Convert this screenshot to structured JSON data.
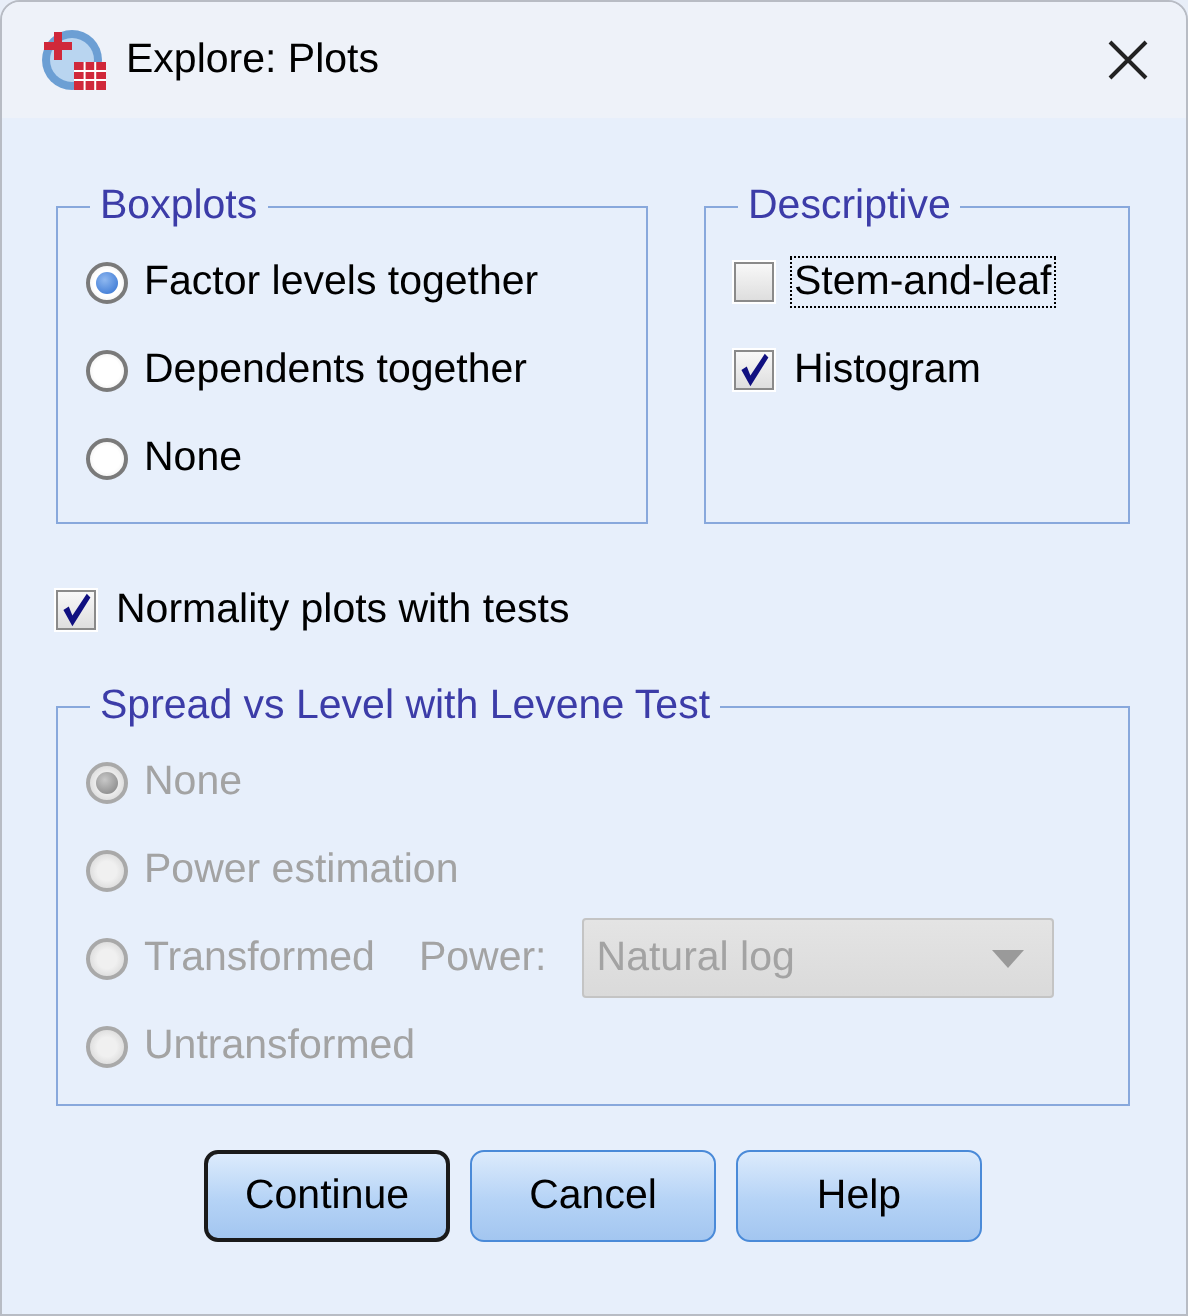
{
  "window": {
    "title": "Explore: Plots"
  },
  "boxplots": {
    "title": "Boxplots",
    "options": [
      {
        "label": "Factor levels together",
        "selected": true
      },
      {
        "label": "Dependents together",
        "selected": false
      },
      {
        "label": "None",
        "selected": false
      }
    ]
  },
  "descriptive": {
    "title": "Descriptive",
    "options": [
      {
        "label": "Stem-and-leaf",
        "checked": false,
        "focused": true
      },
      {
        "label": "Histogram",
        "checked": true,
        "focused": false
      }
    ]
  },
  "normality": {
    "label": "Normality plots with tests",
    "checked": true
  },
  "spread": {
    "title": "Spread vs Level with Levene Test",
    "disabled": true,
    "options": [
      {
        "label": "None",
        "selected": true
      },
      {
        "label": "Power estimation",
        "selected": false
      },
      {
        "label": "Transformed",
        "selected": false,
        "power": {
          "label": "Power:",
          "value": "Natural log"
        }
      },
      {
        "label": "Untransformed",
        "selected": false
      }
    ]
  },
  "buttons": [
    {
      "label": "Continue",
      "default": true
    },
    {
      "label": "Cancel",
      "default": false
    },
    {
      "label": "Help",
      "default": false
    }
  ]
}
